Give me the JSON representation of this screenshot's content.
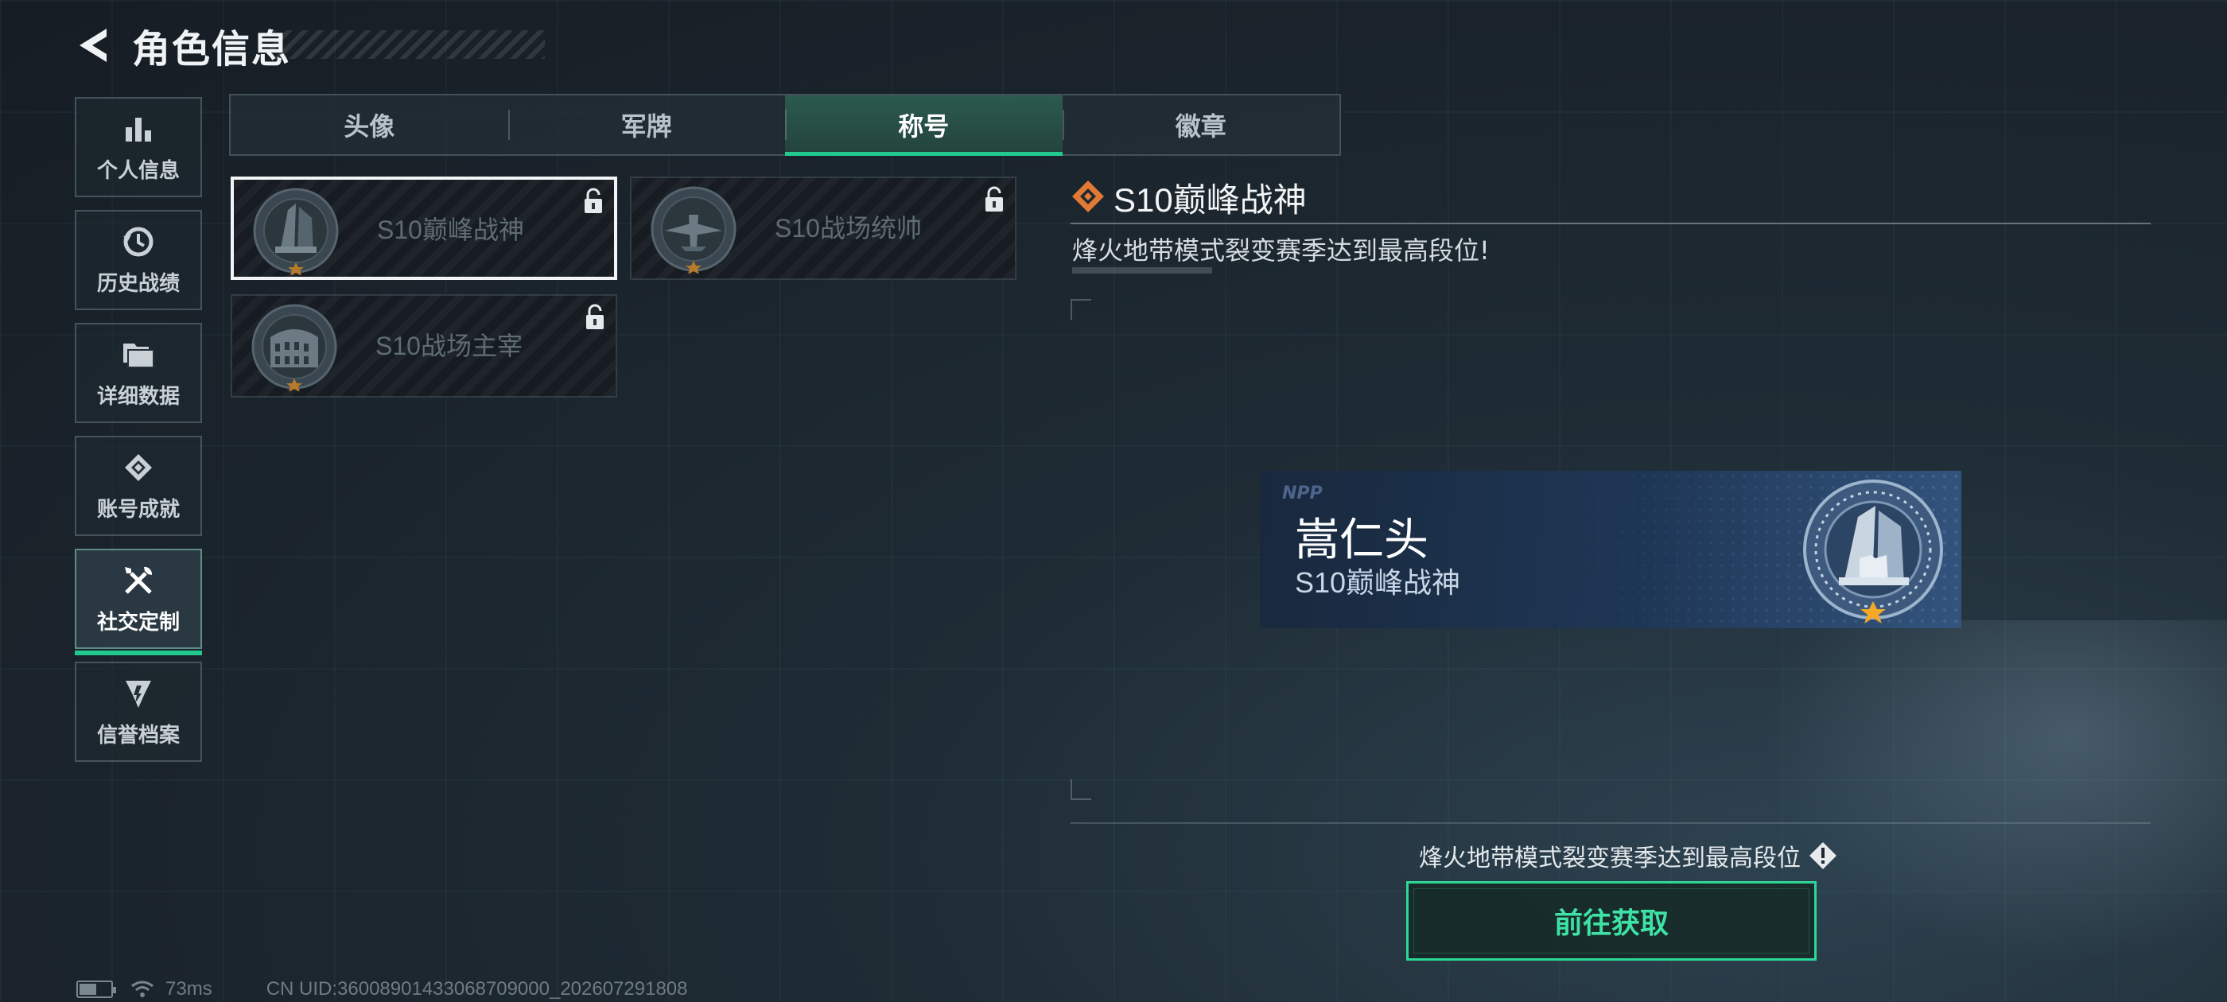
{
  "header": {
    "title": "角色信息",
    "back_icon": "back-chevron-icon"
  },
  "sidebar": {
    "items": [
      {
        "label": "个人信息",
        "icon": "bar-chart-icon",
        "active": false
      },
      {
        "label": "历史战绩",
        "icon": "history-clock-icon",
        "active": false
      },
      {
        "label": "详细数据",
        "icon": "folder-stack-icon",
        "active": false
      },
      {
        "label": "账号成就",
        "icon": "achievement-badge-icon",
        "active": false
      },
      {
        "label": "社交定制",
        "icon": "tools-icon",
        "active": true
      },
      {
        "label": "信誉档案",
        "icon": "credit-shield-icon",
        "active": false
      }
    ]
  },
  "tabs": [
    {
      "label": "头像",
      "active": false
    },
    {
      "label": "军牌",
      "active": false
    },
    {
      "label": "称号",
      "active": true
    },
    {
      "label": "徽章",
      "active": false
    }
  ],
  "titles": [
    {
      "name": "S10巅峰战神",
      "locked": true,
      "selected": true,
      "emblem": "peak-tower-emblem-icon"
    },
    {
      "name": "S10战场统帅",
      "locked": true,
      "selected": false,
      "emblem": "aircraft-emblem-icon"
    },
    {
      "name": "S10战场主宰",
      "locked": true,
      "selected": false,
      "emblem": "colosseum-emblem-icon"
    }
  ],
  "detail": {
    "title": "S10巅峰战神",
    "description": "烽火地带模式裂变赛季达到最高段位!",
    "preview": {
      "watermark": "NPP",
      "player_name": "嵩仁头",
      "player_title": "S10巅峰战神"
    },
    "requirement": "烽火地带模式裂变赛季达到最高段位",
    "cta_label": "前往获取"
  },
  "footer": {
    "battery_level": 0.55,
    "ping": "73ms",
    "uid": "CN UID:3600890143306870900​0_202607291808"
  },
  "colors": {
    "accent": "#22c98e",
    "cta": "#2bd898",
    "title_diamond": "#e07a34",
    "star": "#f2a928"
  }
}
